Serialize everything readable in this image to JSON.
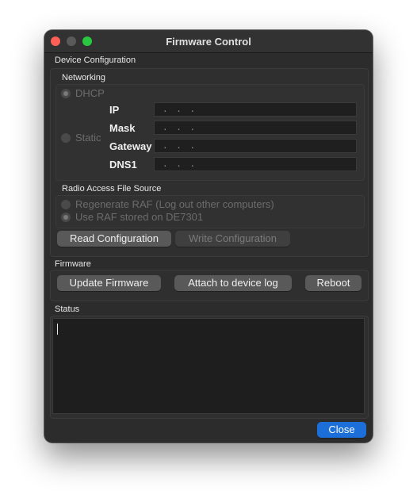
{
  "window": {
    "title": "Firmware Control"
  },
  "device_configuration": {
    "label": "Device Configuration",
    "networking": {
      "label": "Networking",
      "dhcp_label": "DHCP",
      "static_label": "Static",
      "selected": "DHCP",
      "fields": [
        {
          "label": "IP",
          "value": ".   .   ."
        },
        {
          "label": "Mask",
          "value": ".   .   ."
        },
        {
          "label": "Gateway",
          "value": ".   .   ."
        },
        {
          "label": "DNS1",
          "value": ".   .   ."
        }
      ]
    },
    "raf": {
      "label": "Radio Access File Source",
      "regenerate_label": "Regenerate RAF (Log out other computers)",
      "stored_label": "Use RAF stored on DE7301",
      "selected": "Use RAF stored on DE7301"
    },
    "read_button": "Read Configuration",
    "write_button": "Write Configuration"
  },
  "firmware": {
    "label": "Firmware",
    "update_button": "Update Firmware",
    "attach_button": "Attach to device log",
    "reboot_button": "Reboot"
  },
  "status": {
    "label": "Status",
    "text": ""
  },
  "close_button": "Close"
}
